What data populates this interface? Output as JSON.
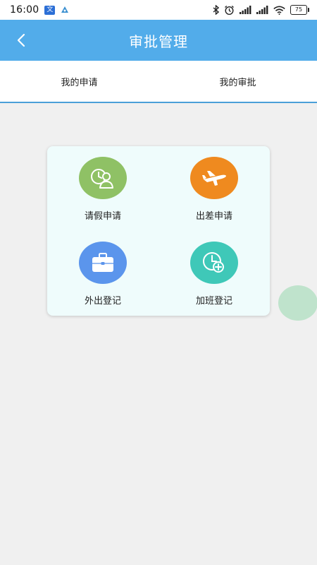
{
  "status_bar": {
    "time": "16:00",
    "app_icon_1": "translate-app-icon",
    "app_icon_2": "notification-app-icon",
    "battery": "75",
    "icons": [
      "bluetooth-icon",
      "alarm-icon",
      "signal-icon",
      "signal-icon",
      "wifi-icon",
      "battery-icon"
    ]
  },
  "header": {
    "title": "审批管理",
    "back_icon": "chevron-left-icon",
    "background": "#52acea"
  },
  "tabs": [
    {
      "label": "我的申请"
    },
    {
      "label": "我的审批"
    }
  ],
  "grid": [
    {
      "label": "请假申请",
      "icon": "clock-person-icon",
      "color": "#8fc165"
    },
    {
      "label": "出差申请",
      "icon": "airplane-icon",
      "color": "#ef8a1f"
    },
    {
      "label": "外出登记",
      "icon": "briefcase-icon",
      "color": "#5b95ec"
    },
    {
      "label": "加班登记",
      "icon": "clock-plus-icon",
      "color": "#3fc8b8"
    }
  ],
  "colors": {
    "page_background": "#f0f0f0",
    "card_background": "#effcfc",
    "tab_underline": "#4a9fd8",
    "floating_button": "#bfe3cc"
  }
}
